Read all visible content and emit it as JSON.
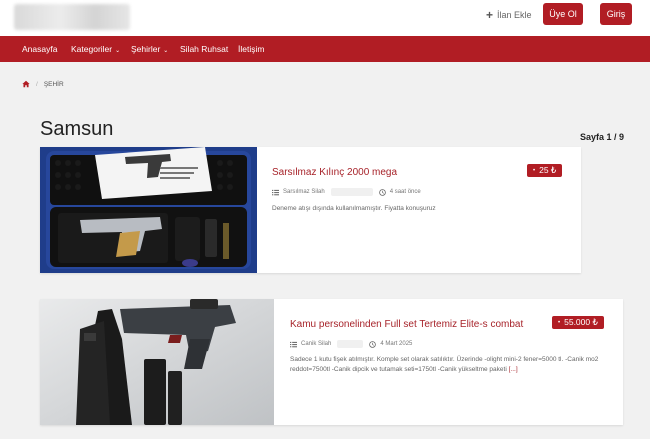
{
  "header": {
    "ilan_ekle": "İlan Ekle",
    "uye_ol": "Üye Ol",
    "giris": "Giriş"
  },
  "nav": {
    "items": [
      "Anasayfa",
      "Kategoriler",
      "Şehirler",
      "Silah Ruhsat",
      "İletişim"
    ]
  },
  "breadcrumb": {
    "current": "ŞEHİR"
  },
  "page": {
    "title": "Samsun",
    "pager": "Sayfa 1 / 9"
  },
  "listings": [
    {
      "title": "Sarsılmaz Kılınç 2000 mega",
      "price": "25 ₺",
      "category": "Sarsılmaz Silah",
      "time": "4 saat önce",
      "description": "Deneme atışı dışında kullanılmamıştır. Fiyatta konuşuruz",
      "more": ""
    },
    {
      "title": "Kamu personelinden Full set Tertemiz Elite-s combat",
      "price": "55.000 ₺",
      "category": "Canik Silah",
      "time": "4 Mart 2025",
      "description": "Sadece 1 kutu fişek atılmıştır. Komple set olarak satılıktır. Üzerinde -olight mini-2 fener=5000 tl. -Canik mo2 reddot=7500tl -Canik dipcik ve tutamak seti=1750tl -Canik yükseltme paketi",
      "more": "[...]"
    }
  ],
  "colors": {
    "brand": "#b11d24",
    "title": "#a7232a"
  }
}
